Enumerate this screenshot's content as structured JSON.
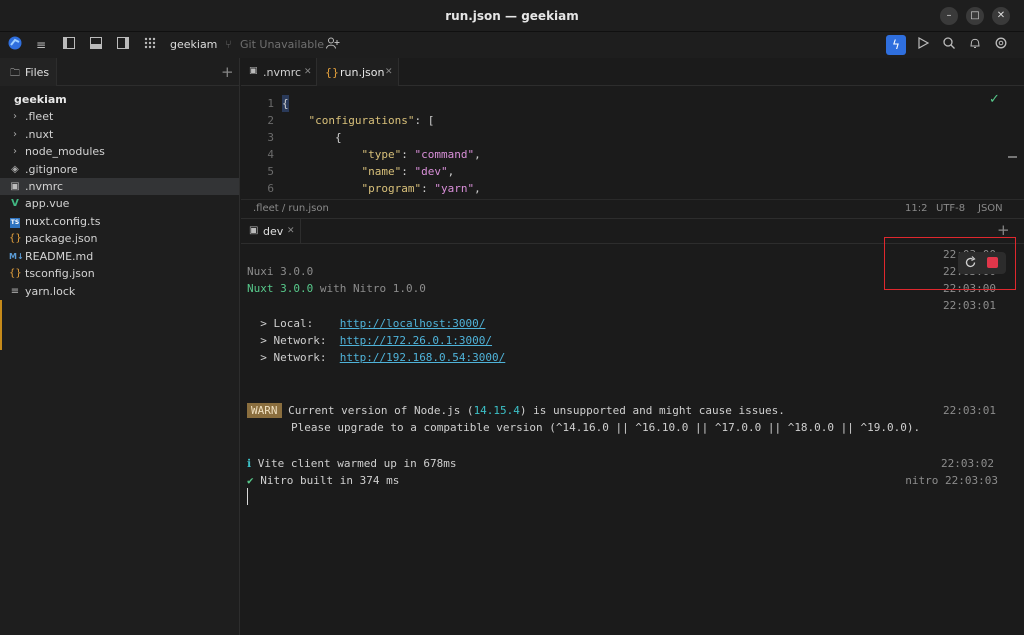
{
  "window": {
    "title": "run.json — geekiam"
  },
  "toolbar": {
    "project": "geekiam",
    "git_status": "Git Unavailable"
  },
  "sidebar": {
    "tab_label": "Files",
    "project_name": "geekiam",
    "items": [
      {
        "label": ".fleet",
        "icon": "chevron-right-icon"
      },
      {
        "label": ".nuxt",
        "icon": "chevron-right-icon"
      },
      {
        "label": "node_modules",
        "icon": "chevron-right-icon"
      },
      {
        "label": ".gitignore",
        "icon": "git-icon"
      },
      {
        "label": ".nvmrc",
        "icon": "file-terminal-icon"
      },
      {
        "label": "app.vue",
        "icon": "vue-icon"
      },
      {
        "label": "nuxt.config.ts",
        "icon": "ts-icon"
      },
      {
        "label": "package.json",
        "icon": "json-icon"
      },
      {
        "label": "README.md",
        "icon": "markdown-icon"
      },
      {
        "label": "tsconfig.json",
        "icon": "json-icon"
      },
      {
        "label": "yarn.lock",
        "icon": "lines-icon"
      }
    ]
  },
  "editor": {
    "tabs": [
      {
        "label": ".nvmrc"
      },
      {
        "label": "run.json"
      }
    ],
    "lines": [
      {
        "n": "1",
        "text": "{"
      },
      {
        "n": "2",
        "key": "\"configurations\"",
        "rest": ": ["
      },
      {
        "n": "3",
        "text": "        {"
      },
      {
        "n": "4",
        "key": "\"type\"",
        "val": "\"command\""
      },
      {
        "n": "5",
        "key": "\"name\"",
        "val": "\"dev\""
      },
      {
        "n": "6",
        "key": "\"program\"",
        "val": "\"yarn\""
      }
    ],
    "breadcrumb": ".fleet / run.json",
    "cursor_pos": "11:2",
    "encoding": "UTF-8",
    "language": "JSON"
  },
  "terminal": {
    "tab_label": "dev",
    "lines": {
      "nuxi": "Nuxi 3.0.0",
      "nuxt_prefix": "Nuxt 3.0.0",
      "nuxt_suffix": " with Nitro 1.0.0",
      "local_label": "  > Local:    ",
      "local_url": "http://localhost:3000/",
      "net1_label": "  > Network:  ",
      "net1_url": "http://172.26.0.1:3000/",
      "net2_label": "  > Network:  ",
      "net2_url": "http://192.168.0.54:3000/",
      "warn_badge": "WARN",
      "warn_text1_a": "Current version of Node.js (",
      "warn_version": "14.15.4",
      "warn_text1_b": ") is unsupported and might cause issues.",
      "warn_text2": "Please upgrade to a compatible version (^14.16.0 || ^16.10.0 || ^17.0.0 || ^18.0.0 || ^19.0.0).",
      "vite_icon": "ℹ",
      "vite_text": " Vite client warmed up in 678ms",
      "nitro_icon": "✔",
      "nitro_text": " Nitro built in 374 ms"
    },
    "timestamps": {
      "t1": "22:03:00",
      "t2": "22:03:00",
      "t3": "22:03:00",
      "t4": "22:03:01",
      "t5": "22:03:01",
      "t6": "22:03:02",
      "t7": "nitro 22:03:03"
    }
  },
  "colors": {
    "accent": "#2f6fde",
    "stop": "#e0364a",
    "highlight": "#e0282e"
  }
}
